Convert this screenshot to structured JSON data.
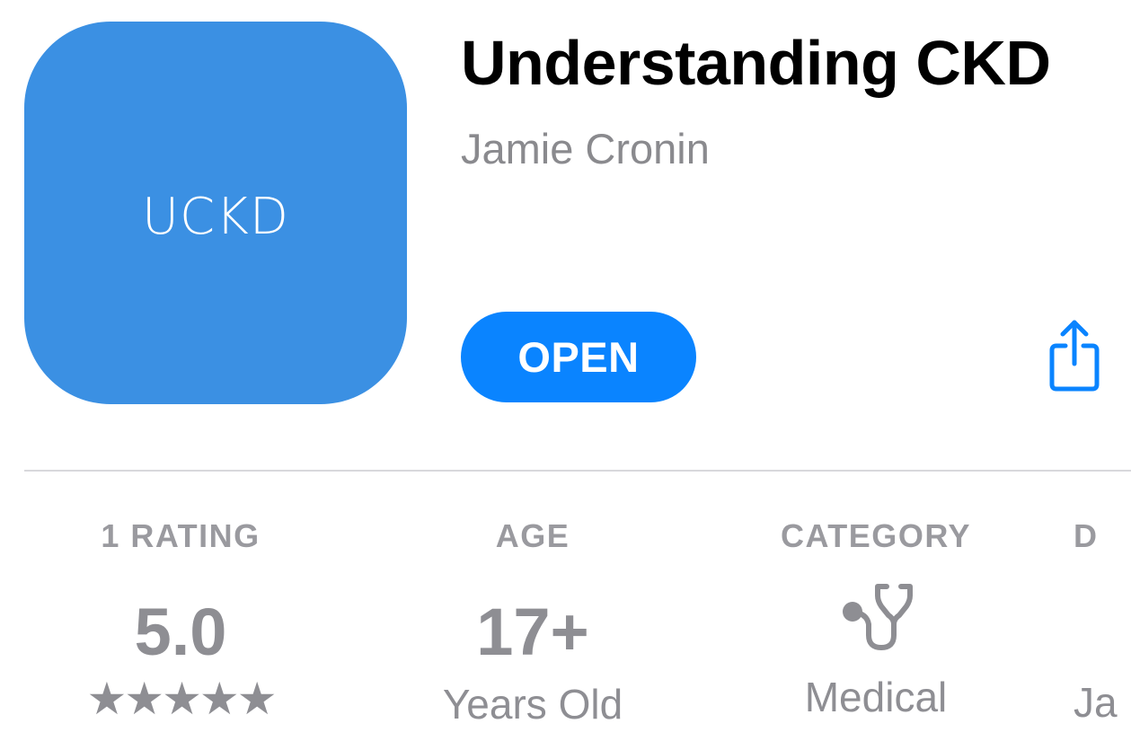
{
  "app": {
    "icon_text": "UCKD",
    "icon_color": "#3b90e3",
    "title": "Understanding CKD",
    "developer": "Jamie Cronin",
    "open_label": "OPEN",
    "open_color": "#0a84ff",
    "share_icon": "share-icon"
  },
  "info": {
    "ratings": {
      "header": "1 RATING",
      "value": "5.0",
      "stars": "★★★★★",
      "star_count": 5
    },
    "age": {
      "header": "AGE",
      "value": "17+",
      "sub": "Years Old"
    },
    "category": {
      "header": "CATEGORY",
      "icon": "stethoscope-icon",
      "sub": "Medical"
    },
    "developer": {
      "header": "D",
      "sub": "Ja"
    }
  }
}
